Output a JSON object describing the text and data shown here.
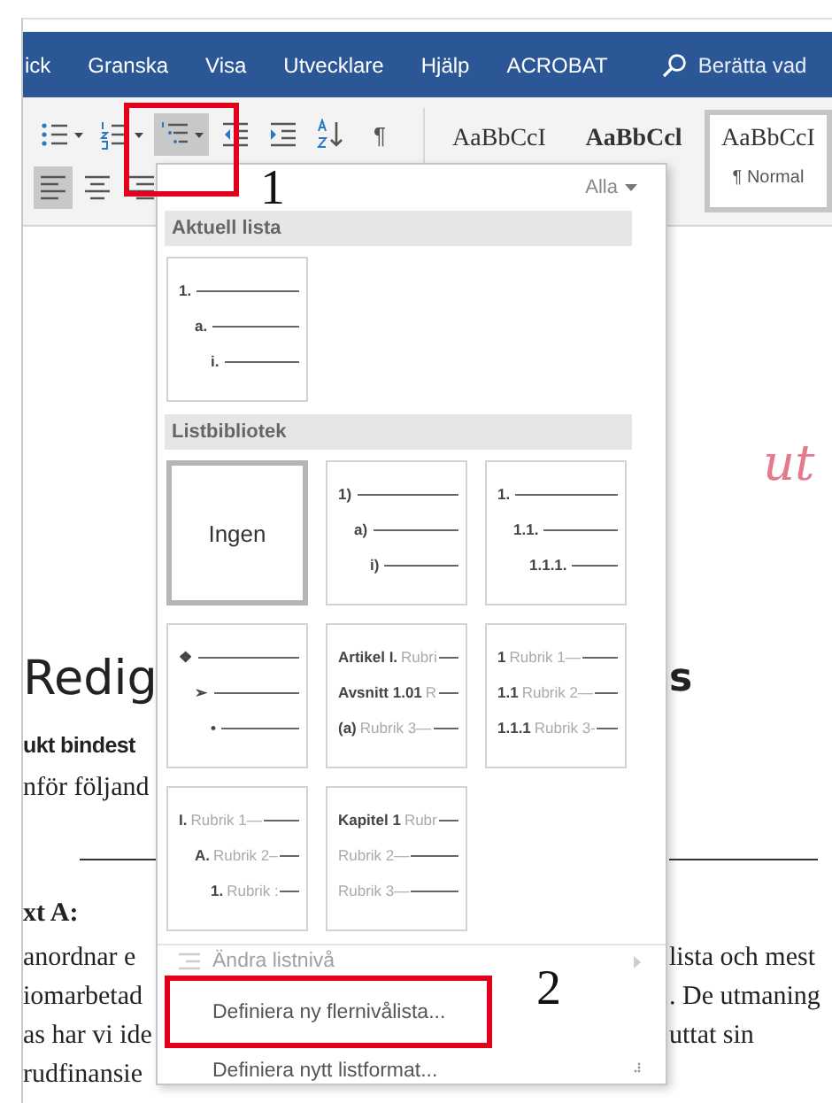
{
  "ribbon_tabs": [
    {
      "label": "ick"
    },
    {
      "label": "Granska"
    },
    {
      "label": "Visa"
    },
    {
      "label": "Utvecklare"
    },
    {
      "label": "Hjälp"
    },
    {
      "label": "ACROBAT"
    }
  ],
  "tell_me": {
    "placeholder": "Berätta vad"
  },
  "toolbar": {
    "list_buttons": [
      {
        "kind": "bullets",
        "selected": false
      },
      {
        "kind": "numbering",
        "selected": false
      },
      {
        "kind": "multilevel",
        "selected": true
      },
      {
        "kind": "outdent",
        "selected": false
      },
      {
        "kind": "indent",
        "selected": false
      },
      {
        "kind": "sort",
        "selected": false
      }
    ],
    "pilcrow": "¶",
    "align_buttons": [
      {
        "kind": "left",
        "selected": true
      },
      {
        "kind": "center",
        "selected": false
      },
      {
        "kind": "right",
        "selected": false
      }
    ],
    "styles": [
      {
        "sample": "AaBbCcI",
        "bold": false,
        "selected": false
      },
      {
        "sample": "AaBbCcl",
        "bold": true,
        "selected": false
      },
      {
        "sample": "AaBbCcI",
        "bold": false,
        "selected": true,
        "name": "¶ Normal"
      }
    ]
  },
  "dropdown": {
    "filter": "Alla",
    "sections": [
      {
        "title": "Aktuell lista",
        "tiles": [
          {
            "kind": "list",
            "selected": false,
            "items": [
              {
                "marker": "1.",
                "children": [
                  {
                    "marker": "a.",
                    "children": [
                      {
                        "marker": "i."
                      }
                    ]
                  }
                ]
              }
            ]
          }
        ]
      },
      {
        "title": "Listbibliotek",
        "tiles": [
          {
            "kind": "none",
            "selected": true,
            "label": "Ingen"
          },
          {
            "kind": "list",
            "selected": false,
            "items": [
              {
                "marker": "1)",
                "children": [
                  {
                    "marker": "a)",
                    "children": [
                      {
                        "marker": "i)"
                      }
                    ]
                  }
                ]
              }
            ]
          },
          {
            "kind": "list",
            "selected": false,
            "items": [
              {
                "marker": "1.",
                "children": [
                  {
                    "marker": "1.1.",
                    "children": [
                      {
                        "marker": "1.1.1."
                      }
                    ]
                  }
                ]
              }
            ]
          },
          {
            "kind": "list",
            "selected": false,
            "items": [
              {
                "marker": "❖",
                "children": [
                  {
                    "marker": "➢",
                    "children": [
                      {
                        "marker": "•"
                      }
                    ]
                  }
                ]
              }
            ]
          },
          {
            "kind": "list",
            "selected": false,
            "items": [
              {
                "marker": "Artikel I.",
                "text": "Rubri"
              },
              {
                "marker": "Avsnitt 1.01",
                "text": "R"
              },
              {
                "marker": "(a)",
                "text": "Rubrik 3—"
              }
            ]
          },
          {
            "kind": "list",
            "selected": false,
            "items": [
              {
                "marker": "1",
                "text": "Rubrik 1—"
              },
              {
                "marker": "1.1",
                "text": "Rubrik 2—"
              },
              {
                "marker": "1.1.1",
                "text": "Rubrik 3-"
              }
            ]
          },
          {
            "kind": "list",
            "selected": false,
            "items": [
              {
                "marker": "I.",
                "text": "Rubrik 1—",
                "children": [
                  {
                    "marker": "A.",
                    "text": "Rubrik 2–",
                    "children": [
                      {
                        "marker": "1.",
                        "text": "Rubrik :"
                      }
                    ]
                  }
                ]
              }
            ]
          },
          {
            "kind": "list",
            "selected": false,
            "items": [
              {
                "marker": "Kapitel 1",
                "text": "Rubr"
              },
              {
                "text": "Rubrik 2—"
              },
              {
                "text": "Rubrik 3—"
              }
            ]
          }
        ]
      }
    ],
    "menu": [
      {
        "label": "Ändra listnivå",
        "disabled": true,
        "submenu": true
      },
      {
        "label": "Definiera ny flernivålista...",
        "disabled": false,
        "submenu": false
      },
      {
        "label": "Definiera nytt listformat...",
        "disabled": false,
        "submenu": false
      }
    ]
  },
  "document": {
    "rows": [
      {
        "kind": "script",
        "right": "ut"
      },
      {
        "kind": "heading",
        "left": "Redig",
        "right": "s"
      },
      {
        "kind": "subheading",
        "left": "ukt bindest"
      },
      {
        "kind": "body",
        "left": "nför följand"
      },
      {
        "kind": "rule"
      },
      {
        "kind": "label",
        "left": "xt A:"
      },
      {
        "kind": "body",
        "left": "anordnar e",
        "right": "lista och mest"
      },
      {
        "kind": "body",
        "left": "iomarbetad",
        "right": ". De utmaning"
      },
      {
        "kind": "body",
        "left": "as har vi ide",
        "right": "uttat sin"
      },
      {
        "kind": "body",
        "left": "rudfinansie"
      }
    ]
  },
  "annotations": [
    {
      "label": "1"
    },
    {
      "label": "2"
    }
  ]
}
